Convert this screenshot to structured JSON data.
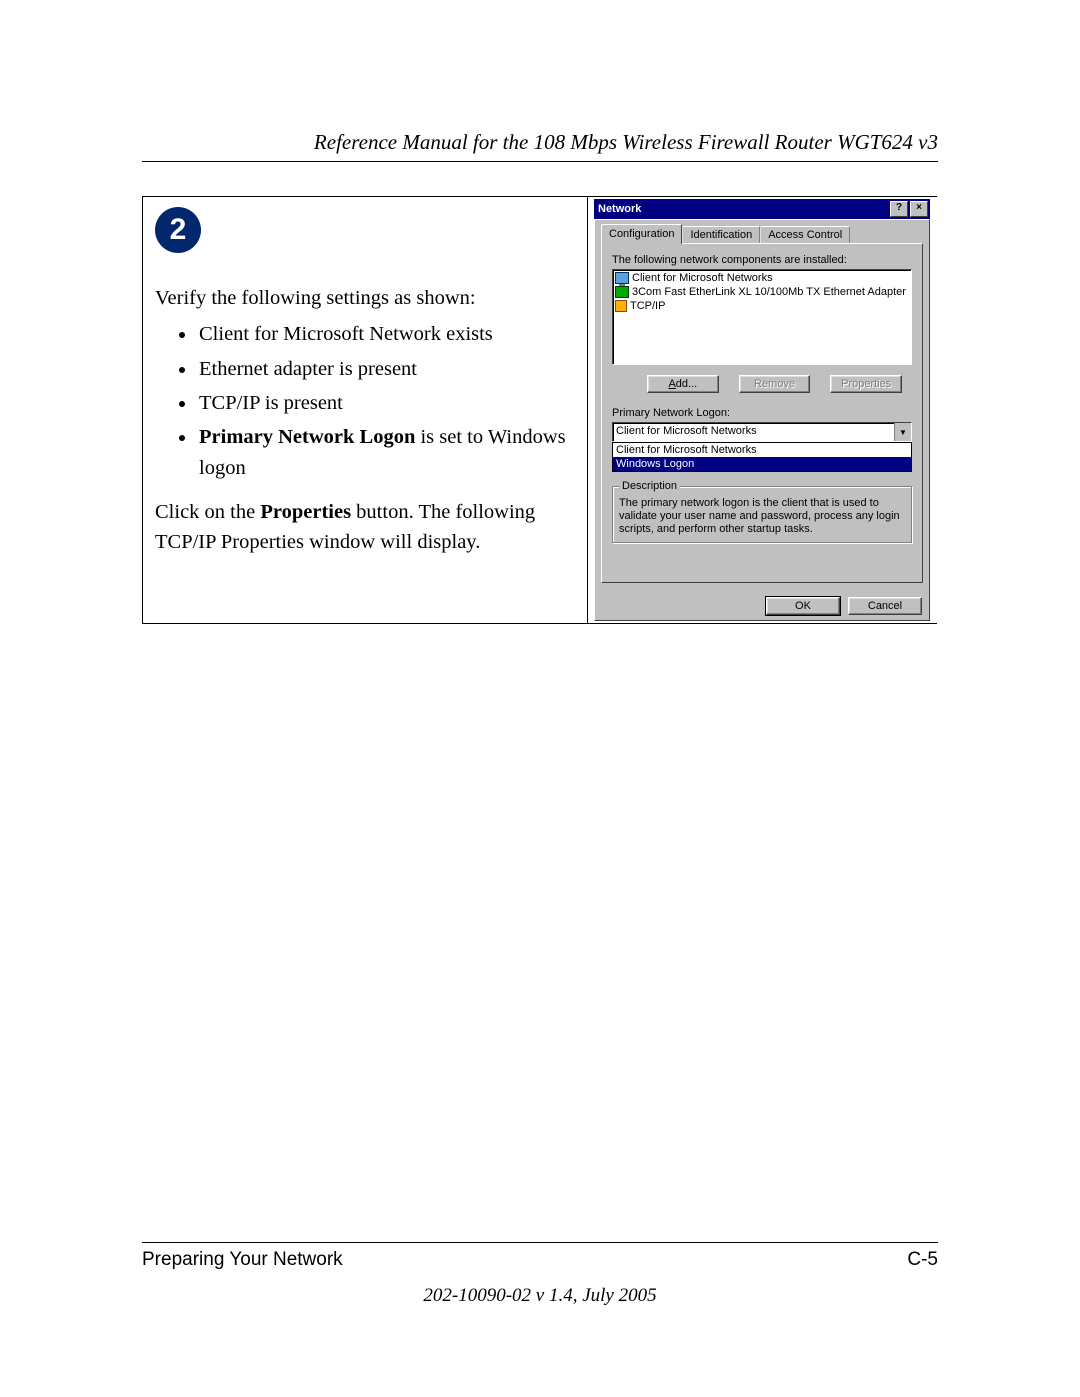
{
  "header": {
    "title": "Reference Manual for the 108 Mbps Wireless Firewall Router WGT624 v3"
  },
  "step": {
    "number": "2",
    "intro": "Verify the following settings as shown:",
    "bullets": [
      {
        "text": "Client for Microsoft Network exists"
      },
      {
        "text": "Ethernet adapter is present"
      },
      {
        "text": "TCP/IP is present"
      },
      {
        "html_bold": "Primary Network Logon",
        "html_rest": " is set to Windows logon"
      }
    ],
    "after_part1": "Click on the ",
    "after_bold": "Properties",
    "after_part2": " button. The following TCP/IP Properties window will display."
  },
  "dialog": {
    "title": "Network",
    "helpbtn": "?",
    "closebtn": "×",
    "tabs": [
      "Configuration",
      "Identification",
      "Access Control"
    ],
    "components_label": "The following network components are installed:",
    "components": [
      "Client for Microsoft Networks",
      "3Com Fast EtherLink XL 10/100Mb TX Ethernet Adapter",
      "TCP/IP"
    ],
    "buttons": {
      "add": "Add...",
      "remove": "Remove",
      "properties": "Properties"
    },
    "primary_label": "Primary Network Logon:",
    "primary_value": "Client for Microsoft Networks",
    "primary_options": [
      "Client for Microsoft Networks",
      "Windows Logon"
    ],
    "desc_legend": "Description",
    "desc_text": "The primary network logon is the client that is used to validate your user name and password, process any login scripts, and perform other startup tasks.",
    "ok": "OK",
    "cancel": "Cancel"
  },
  "footer": {
    "section": "Preparing Your Network",
    "page": "C-5",
    "docid": "202-10090-02 v 1.4, July 2005"
  }
}
